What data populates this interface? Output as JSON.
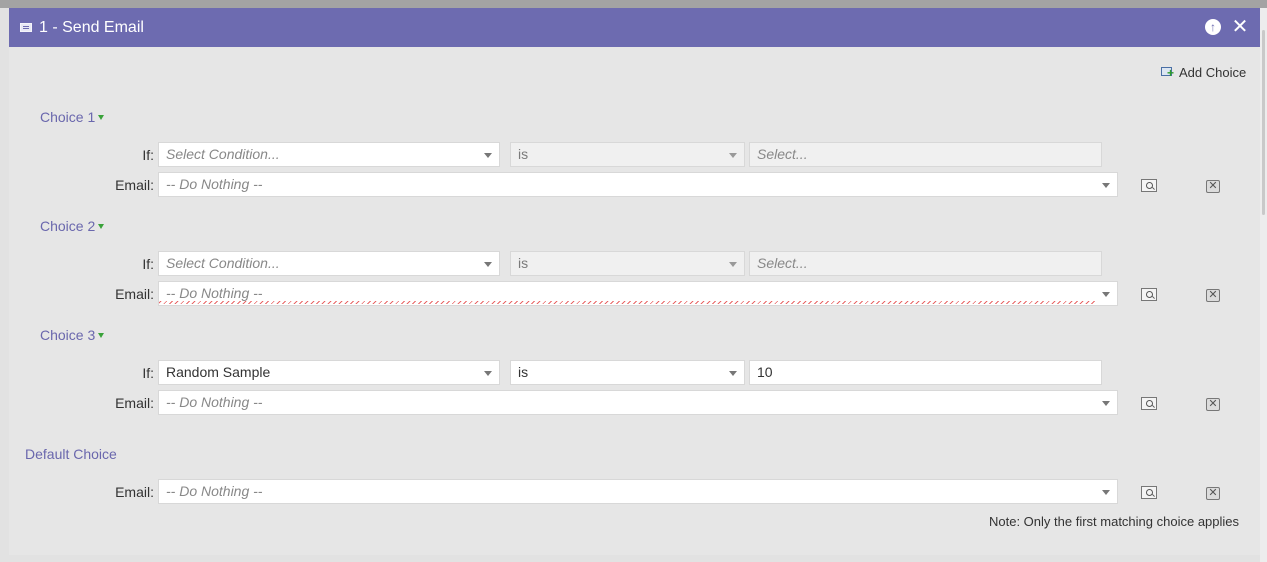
{
  "window": {
    "title": "1 - Send Email",
    "icons": {
      "title": "email-icon",
      "collapse": "arrow-up-circle-icon",
      "close": "close-icon"
    }
  },
  "toolbar": {
    "add_choice_label": "Add Choice"
  },
  "labels": {
    "if": "If:",
    "email": "Email:"
  },
  "choices": [
    {
      "label": "Choice 1",
      "condition": {
        "value": "Select Condition...",
        "is_placeholder": true
      },
      "operator": "is",
      "operator_disabled": true,
      "value": {
        "value": "Select...",
        "is_placeholder": true,
        "disabled": true
      },
      "email": "-- Do Nothing --"
    },
    {
      "label": "Choice 2",
      "condition": {
        "value": "Select Condition...",
        "is_placeholder": true
      },
      "operator": "is",
      "operator_disabled": true,
      "value": {
        "value": "Select...",
        "is_placeholder": true,
        "disabled": true
      },
      "email": "-- Do Nothing --"
    },
    {
      "label": "Choice 3",
      "condition": {
        "value": "Random Sample",
        "is_placeholder": false
      },
      "operator": "is",
      "operator_disabled": false,
      "value": {
        "value": "10",
        "is_placeholder": false,
        "disabled": false
      },
      "email": "-- Do Nothing --"
    }
  ],
  "default_choice": {
    "label": "Default Choice",
    "email": "-- Do Nothing --"
  },
  "note": "Note: Only the first matching choice applies",
  "colors": {
    "titlebar": "#6d6bb0",
    "choice_label": "#6a67ad",
    "panel_bg": "#e6e6e6"
  }
}
